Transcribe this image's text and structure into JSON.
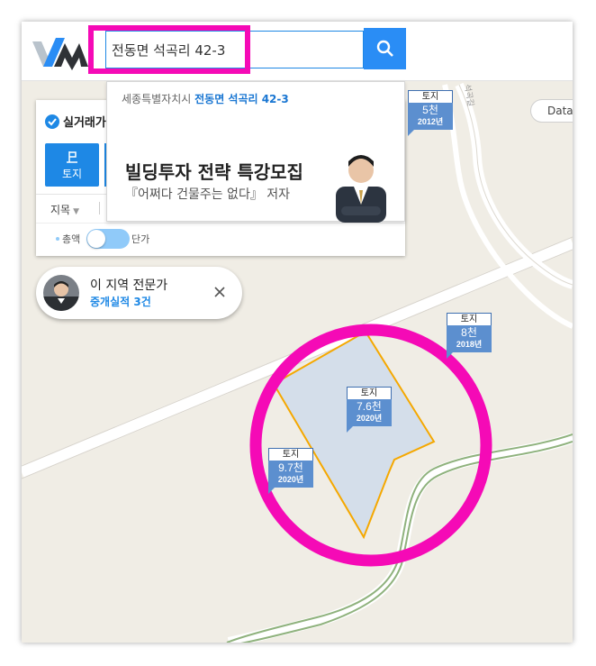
{
  "search": {
    "query": "전동면 석곡리 42-3"
  },
  "dropdown": {
    "suggest_prefix": "세종특별자치시",
    "suggest_match": "전동면 석곡리 42-3",
    "ad_title": "빌딩투자 전략 특강모집",
    "ad_subtitle": "『어쩌다 건물주는 없다』 저자"
  },
  "panel": {
    "title": "실거래가",
    "tab_land_label": "토지",
    "filter_jimok": "지목",
    "toggle_left": "총액",
    "toggle_right": "단가"
  },
  "expert": {
    "title": "이 지역 전문가",
    "subtitle": "중개실적 3건"
  },
  "data_chip": "Data",
  "markers": [
    {
      "type": "토지",
      "price": "5천",
      "year": "2012년"
    },
    {
      "type": "토지",
      "price": "8천",
      "year": "2018년"
    },
    {
      "type": "토지",
      "price": "7.6천",
      "year": "2020년"
    },
    {
      "type": "토지",
      "price": "9.7천",
      "year": "2020년"
    }
  ],
  "colors": {
    "accent": "#1e88e5",
    "highlight": "#f50ab6",
    "parcel_outline": "#f5a800",
    "parcel_fill": "#d4deea",
    "marker": "#5c8fcf",
    "map_bg": "#f0ede5"
  }
}
